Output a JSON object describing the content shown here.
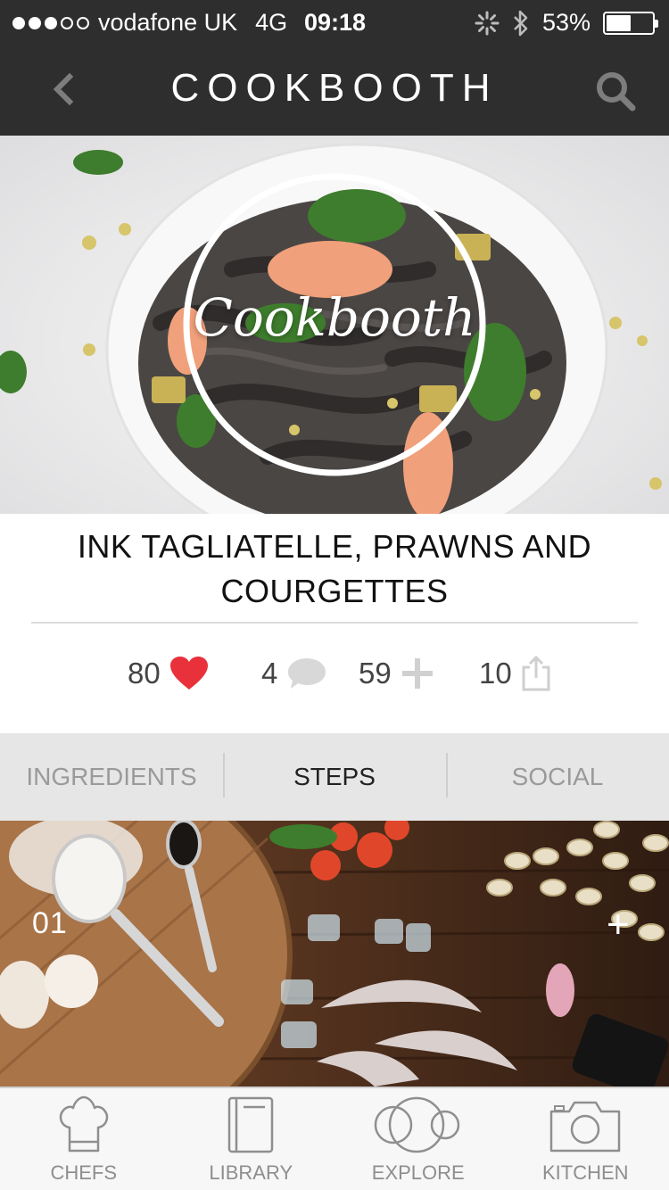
{
  "status_bar": {
    "carrier": "vodafone UK",
    "network": "4G",
    "time": "09:18",
    "battery": "53%",
    "battery_level": 0.53,
    "signal_bars_filled": 3,
    "signal_bars_total": 5,
    "icons": [
      "activity-spinner-icon",
      "bluetooth-icon",
      "battery-icon"
    ]
  },
  "nav": {
    "brand": "COOKBOOTH",
    "back_icon": "chevron-left-icon",
    "search_icon": "search-icon"
  },
  "hero": {
    "logo_text": "Cookbooth"
  },
  "recipe": {
    "title_line1": "INK TAGLIATELLE, PRAWNS AND",
    "title_line2": "COURGETTES"
  },
  "stats": {
    "likes": "80",
    "comments": "4",
    "adds": "59",
    "shares": "10",
    "like_color": "#e8313a"
  },
  "tabs": [
    {
      "label": "INGREDIENTS",
      "active": false
    },
    {
      "label": "STEPS",
      "active": true
    },
    {
      "label": "SOCIAL",
      "active": false
    }
  ],
  "step": {
    "number": "01",
    "add_symbol": "+"
  },
  "tabbar": [
    {
      "label": "CHEFS",
      "icon": "chef-hat-icon"
    },
    {
      "label": "LIBRARY",
      "icon": "book-icon"
    },
    {
      "label": "EXPLORE",
      "icon": "explore-circles-icon"
    },
    {
      "label": "KITCHEN",
      "icon": "camera-icon"
    }
  ]
}
